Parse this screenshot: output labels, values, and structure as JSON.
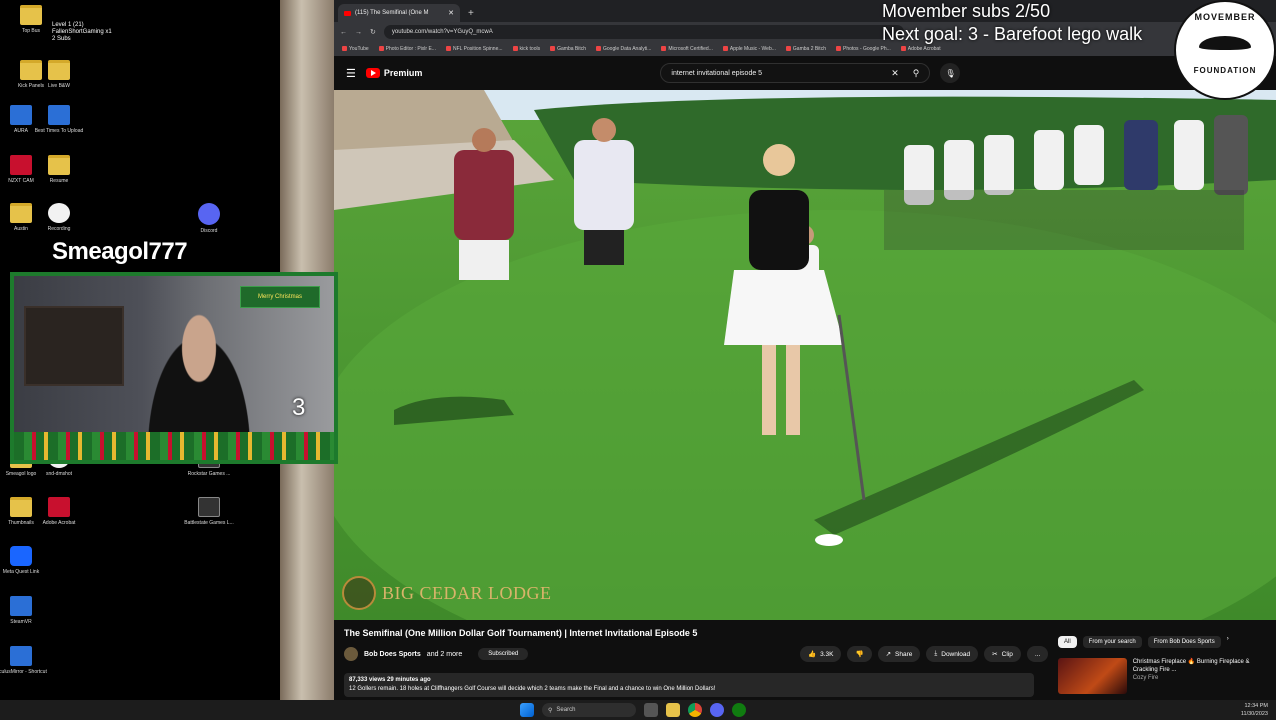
{
  "desktop": {
    "icons": [
      {
        "label": "Top Bus",
        "type": "folder"
      },
      {
        "label": "Kick Panels",
        "type": "folder"
      },
      {
        "label": "Live B&W",
        "type": "folder"
      },
      {
        "label": "AURA",
        "type": "blue"
      },
      {
        "label": "Best Times To Upload",
        "type": "blue"
      },
      {
        "label": "NZXT CAM",
        "type": "red"
      },
      {
        "label": "Resume",
        "type": "folder"
      },
      {
        "label": "Austin",
        "type": "folder"
      },
      {
        "label": "Recording",
        "type": "white"
      },
      {
        "label": "Discord",
        "type": "discord"
      },
      {
        "label": "Smeagol logo",
        "type": "folder"
      },
      {
        "label": "snd-dmshot",
        "type": "white"
      },
      {
        "label": "Rockstar Games ...",
        "type": "dark"
      },
      {
        "label": "Thumbnails",
        "type": "folder"
      },
      {
        "label": "Adobe Acrobat",
        "type": "red"
      },
      {
        "label": "Battlestate Games L...",
        "type": "dark"
      },
      {
        "label": "Meta Quest Link",
        "type": "meta"
      },
      {
        "label": "SteamVR",
        "type": "blue"
      },
      {
        "label": "OculusMirror - Shortcut",
        "type": "blue"
      }
    ],
    "overlay_top_text": "Level 1 (21)",
    "overlay_top_text2": "FallenShortGaming x1",
    "overlay_top_text3": "2 Subs"
  },
  "browser": {
    "tab_title": "(115) The Semifinal (One M",
    "url": "youtube.com/watch?v=YGuyQ_mcwA",
    "bookmarks": [
      "YouTube",
      "Photo Editor : Pixlr E...",
      "NFL Position Spinne...",
      "kick tools",
      "Gamba Bitch",
      "Google Data Analyti...",
      "Microsoft Certified...",
      "Apple Music - Web...",
      "Gamba 2 Bitch",
      "Photos - Google Ph...",
      "Adobe Acrobat"
    ]
  },
  "youtube": {
    "logo_text": "Premium",
    "search_query": "internet invitational episode 5",
    "video_title": "The Semifinal (One Million Dollar Golf Tournament) | Internet Invitational Episode 5",
    "channel": "Bob Does Sports",
    "channel_more": "and 2 more",
    "subscribed_label": "Subscribed",
    "likes": "3.3K",
    "share": "Share",
    "download": "Download",
    "clip": "Clip",
    "more": "...",
    "views_line": "87,333 views  29 minutes ago",
    "description": "12 Gollers remain. 18 holes at Cliffhangers Golf Course will decide which 2 teams make the Final and a chance to win One Million Dollars!",
    "chips": [
      "All",
      "From your search",
      "From Bob Does Sports"
    ],
    "rec_title": "Christmas Fireplace 🔥 Burning Fireplace & Crackling Fire ...",
    "rec_channel": "Cozy Fire",
    "watermark": "BIG CEDAR LODGE"
  },
  "overlays": {
    "goal_line1": "Movember subs 2/50",
    "goal_line2": "Next goal: 3 - Barefoot lego walk",
    "movember_top": "MOVEMBER",
    "movember_bottom": "FOUNDATION",
    "stream_name": "Smeagol777",
    "cam_sign": "Merry Christmas",
    "cam_count": "3"
  },
  "taskbar": {
    "search_placeholder": "Search",
    "time": "12:34 PM",
    "date": "11/30/2023"
  }
}
